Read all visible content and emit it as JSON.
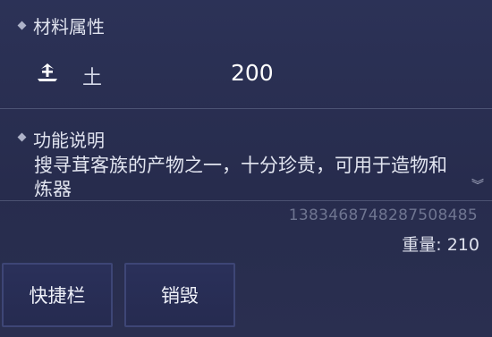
{
  "attributes": {
    "title": "材料属性",
    "element_icon": "earth-element-icon",
    "element_name": "土",
    "element_value": "200"
  },
  "description": {
    "title": "功能说明",
    "text": "搜寻茸客族的产物之一，十分珍贵，可用于造物和炼器"
  },
  "item": {
    "serial": "1383468748287508485",
    "weight_label": "重量",
    "weight_value": "210",
    "weight_text": "重量: 210"
  },
  "buttons": {
    "shortcut_label": "快捷栏",
    "destroy_label": "销毁"
  },
  "colors": {
    "background": "#2a2f50",
    "button_border": "#3e4676",
    "text": "#dfe2ee"
  }
}
